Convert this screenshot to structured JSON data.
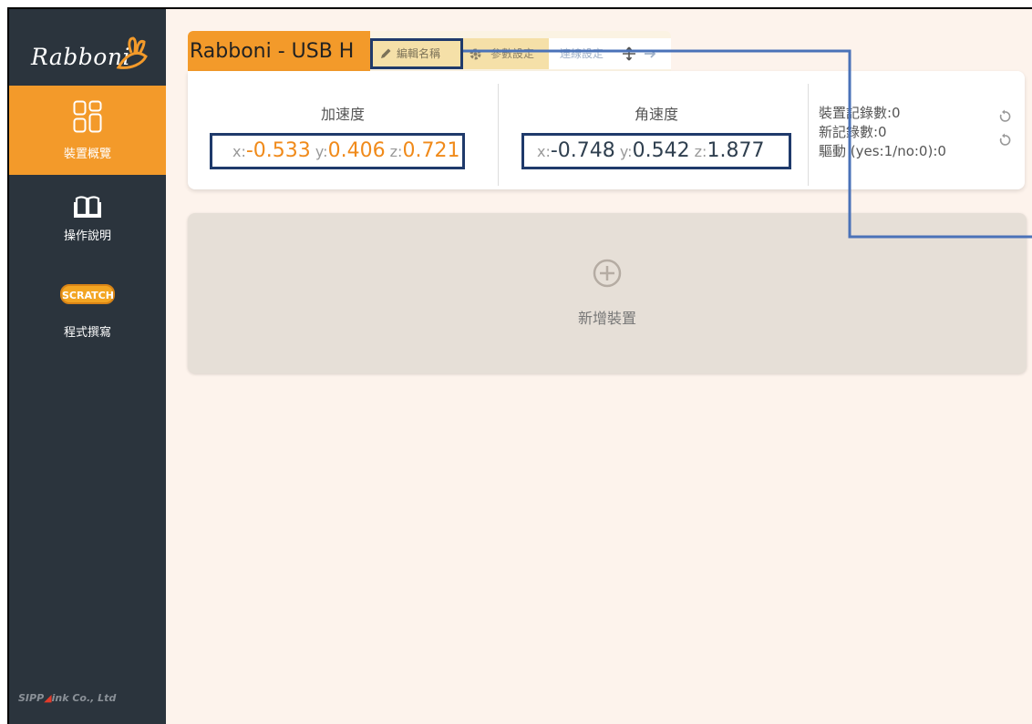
{
  "sidebar": {
    "logo_text": "Rabboni",
    "items": [
      {
        "label": "裝置概覽",
        "active": true
      },
      {
        "label": "操作說明",
        "active": false
      },
      {
        "label": "程式撰寫",
        "active": false
      }
    ],
    "scratch_badge": "SCRATCH",
    "footer_prefix": "SIPP",
    "footer_suffix": "ink Co., Ltd"
  },
  "device": {
    "name": "Rabboni - USB H",
    "actions": {
      "edit_name": "編輯名稱",
      "param_settings": "參數設定",
      "connection_settings": "連線設定"
    },
    "accel": {
      "title": "加速度",
      "x_label": "x:",
      "x": "-0.533",
      "y_label": "y:",
      "y": "0.406",
      "z_label": "z:",
      "z": "0.721"
    },
    "gyro": {
      "title": "角速度",
      "x_label": "x:",
      "x": "-0.748",
      "y_label": "y:",
      "y": "0.542",
      "z_label": "z:",
      "z": "1.877"
    },
    "stats": {
      "device_records": "裝置記錄數:0",
      "new_records": "新記錄數:0",
      "driver": "驅動 (yes:1/no:0):0"
    }
  },
  "add_device": {
    "label": "新增裝置"
  },
  "colors": {
    "sidebar_bg": "#2b343d",
    "accent_orange": "#f39a2a",
    "highlight_box": "#1f3a6b",
    "connector_line": "#4a72b8",
    "page_bg": "#fdf3ec"
  }
}
